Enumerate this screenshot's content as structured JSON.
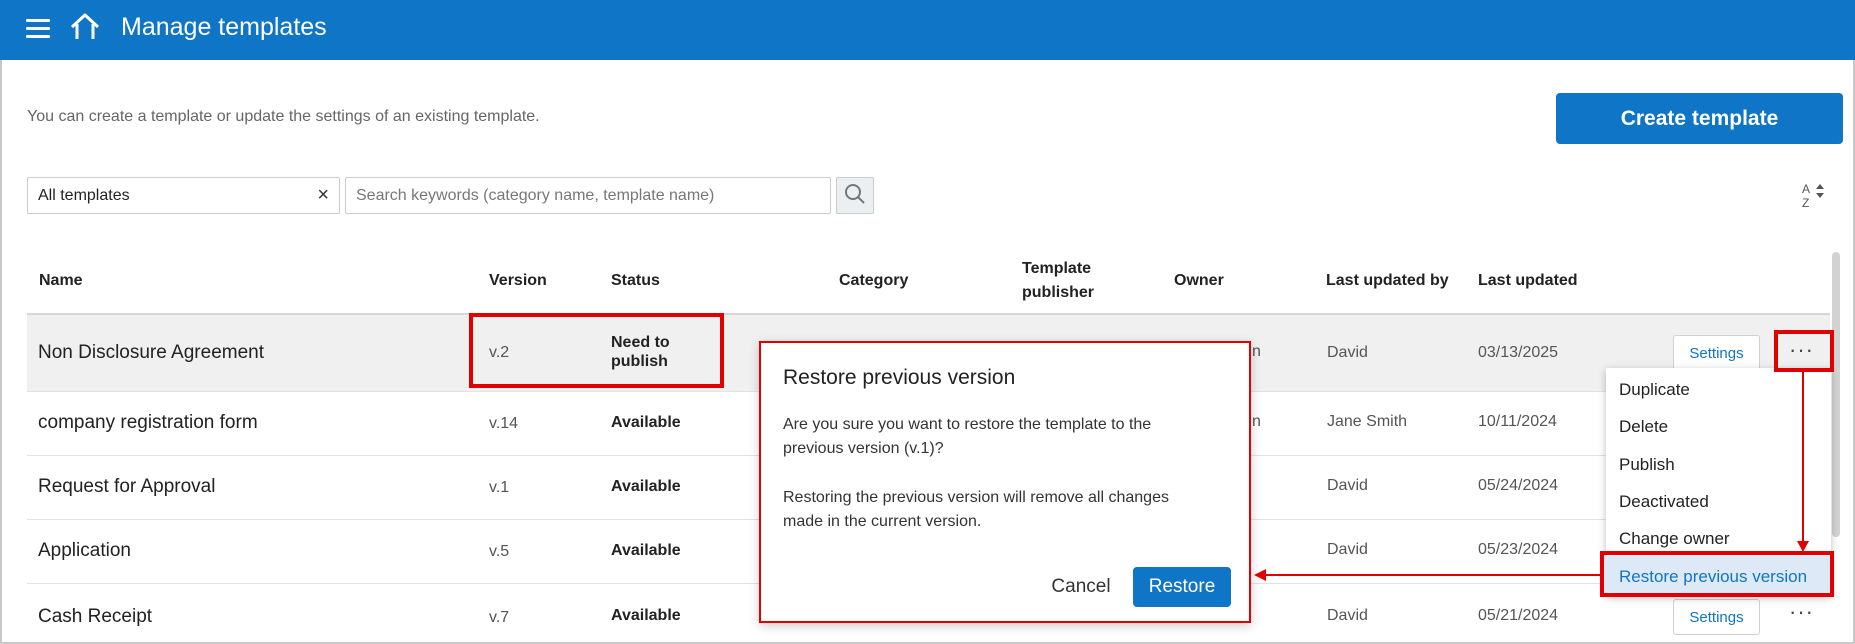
{
  "header": {
    "title": "Manage templates",
    "menu_icon": "hamburger-menu-icon",
    "home_icon": "home-icon"
  },
  "intro": {
    "text": "You can create a template or update the settings of an existing template.",
    "create_label": "Create template"
  },
  "filters": {
    "selected_filter": "All templates",
    "clear_icon": "×",
    "search_placeholder": "Search keywords (category name, template name)"
  },
  "table": {
    "columns": {
      "name": "Name",
      "version": "Version",
      "status": "Status",
      "category": "Category",
      "publisher_line1": "Template",
      "publisher_line2": "publisher",
      "owner": "Owner",
      "last_updated_by": "Last updated by",
      "last_updated": "Last updated"
    },
    "rows": [
      {
        "name": "Non Disclosure Agreement",
        "version": "v.2",
        "status_line1": "Need to",
        "status_line2": "publish",
        "owner_fragment": "n",
        "updated_by": "David",
        "updated": "03/13/2025",
        "settings": "Settings",
        "more": "···"
      },
      {
        "name": "company registration form",
        "version": "v.14",
        "status": "Available",
        "owner_fragment": "n",
        "updated_by": "Jane Smith",
        "updated": "10/11/2024"
      },
      {
        "name": "Request for Approval",
        "version": "v.1",
        "status": "Available",
        "updated_by": "David",
        "updated": "05/24/2024"
      },
      {
        "name": "Application",
        "version": "v.5",
        "status": "Available",
        "updated_by": "David",
        "updated": "05/23/2024"
      },
      {
        "name": "Cash Receipt",
        "version": "v.7",
        "status": "Available",
        "updated_by": "David",
        "updated": "05/21/2024",
        "settings": "Settings",
        "more": "···"
      }
    ]
  },
  "menu": {
    "items": [
      "Duplicate",
      "Delete",
      "Publish",
      "Deactivated",
      "Change owner",
      "Restore previous version"
    ]
  },
  "modal": {
    "title": "Restore previous version",
    "line1": "Are you sure you want to restore the template to the",
    "line2": "previous version (v.1)?",
    "line3": "Restoring the previous version will remove all changes",
    "line4": "made in the current version.",
    "cancel": "Cancel",
    "restore": "Restore"
  },
  "colors": {
    "primary": "#0f75c6",
    "highlight": "#e00000"
  }
}
